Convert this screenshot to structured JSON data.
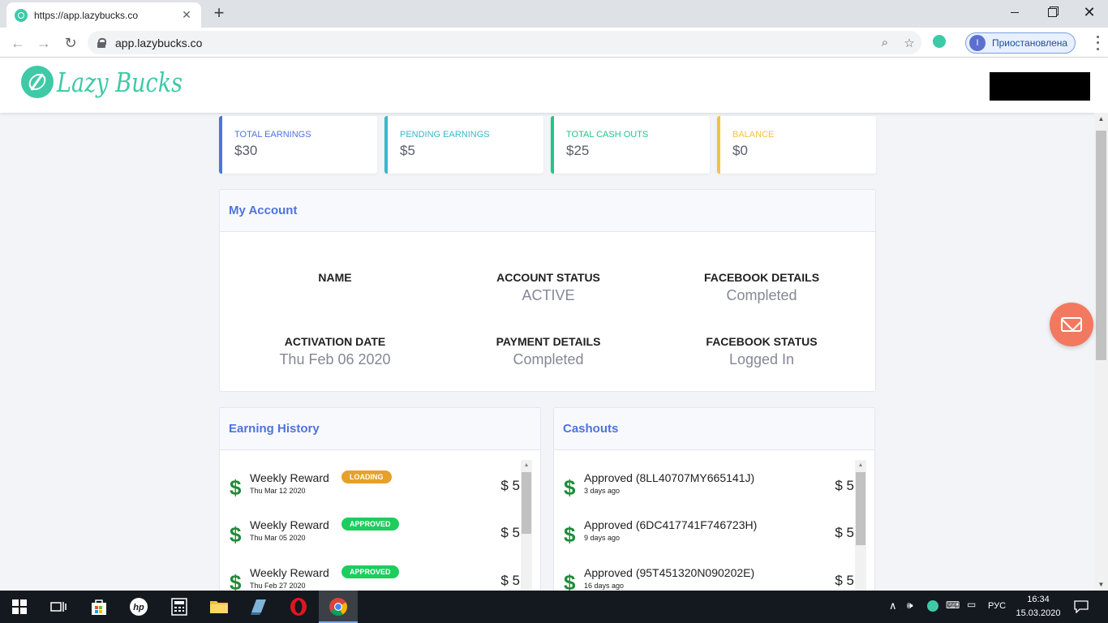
{
  "browser": {
    "tab_title": "https://app.lazybucks.co",
    "url": "app.lazybucks.co",
    "profile_initial": "I",
    "profile_label": "Приостановлена"
  },
  "site": {
    "logo_text": "Lazy Bucks",
    "brand_color": "#3ec9a7"
  },
  "stats": [
    {
      "label": "TOTAL EARNINGS",
      "value": "$30",
      "color": "#4e73df"
    },
    {
      "label": "PENDING EARNINGS",
      "value": "$5",
      "color": "#36b9cc"
    },
    {
      "label": "TOTAL CASH OUTS",
      "value": "$25",
      "color": "#1cc88a"
    },
    {
      "label": "BALANCE",
      "value": "$0",
      "color": "#f6c23e"
    }
  ],
  "account": {
    "title": "My Account",
    "fields": [
      {
        "label": "NAME",
        "value": ""
      },
      {
        "label": "ACCOUNT STATUS",
        "value": "ACTIVE"
      },
      {
        "label": "FACEBOOK DETAILS",
        "value": "Completed"
      },
      {
        "label": "ACTIVATION DATE",
        "value": "Thu Feb 06 2020"
      },
      {
        "label": "PAYMENT DETAILS",
        "value": "Completed"
      },
      {
        "label": "FACEBOOK STATUS",
        "value": "Logged In"
      }
    ]
  },
  "earning_history": {
    "title": "Earning History",
    "items": [
      {
        "title": "Weekly Reward",
        "date": "Thu Mar 12 2020",
        "badge": "LOADING",
        "amount": "$ 5"
      },
      {
        "title": "Weekly Reward",
        "date": "Thu Mar 05 2020",
        "badge": "APPROVED",
        "amount": "$ 5"
      },
      {
        "title": "Weekly Reward",
        "date": "Thu Feb 27 2020",
        "badge": "APPROVED",
        "amount": "$ 5"
      }
    ]
  },
  "cashouts": {
    "title": "Cashouts",
    "items": [
      {
        "title": "Approved (8LL40707MY665141J)",
        "date": "3 days ago",
        "amount": "$ 5"
      },
      {
        "title": "Approved (6DC417741F746723H)",
        "date": "9 days ago",
        "amount": "$ 5"
      },
      {
        "title": "Approved (95T451320N090202E)",
        "date": "16 days ago",
        "amount": "$ 5"
      }
    ]
  },
  "taskbar": {
    "language": "РУС",
    "time": "16:34",
    "date": "15.03.2020"
  }
}
